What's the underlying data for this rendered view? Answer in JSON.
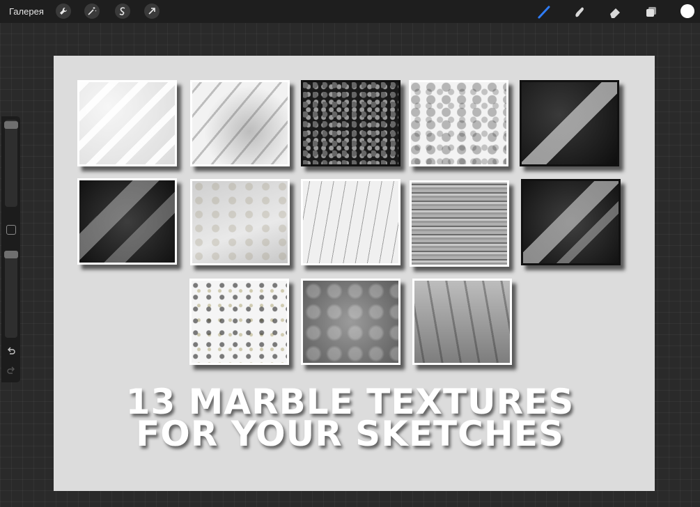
{
  "topbar": {
    "gallery_label": "Галерея",
    "left_tools": [
      "wrench-icon",
      "magic-wand-icon",
      "selection-icon",
      "transform-arrow-icon"
    ],
    "right_tools": [
      "brush-icon",
      "smudge-icon",
      "eraser-icon",
      "layers-icon"
    ],
    "active_tool": "brush-icon",
    "active_color": "#ffffff",
    "accent": "#2f7cf6"
  },
  "sidebar": {
    "brush_size_level": 0.05,
    "opacity_level": 0.02,
    "undo_icon": "undo-icon",
    "redo_icon": "redo-icon"
  },
  "canvas": {
    "headline_line1": "13 MARBLE TEXTURES",
    "headline_line2": "FOR YOUR SKETCHES",
    "texture_count": 13
  }
}
